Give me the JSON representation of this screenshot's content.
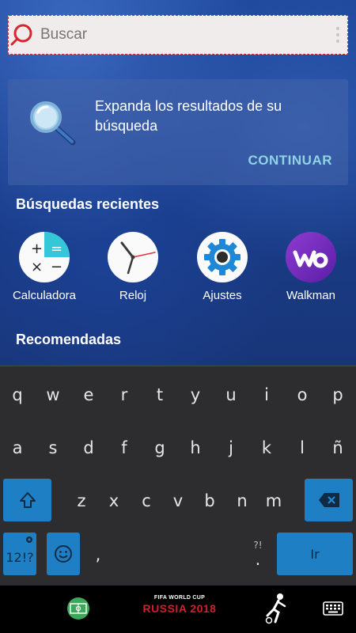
{
  "search": {
    "placeholder": "Buscar"
  },
  "expand_card": {
    "text": "Expanda los resultados de su búsqueda",
    "continue_label": "CONTINUAR"
  },
  "sections": {
    "recent": "Búsquedas recientes",
    "recommended": "Recomendadas"
  },
  "recent_apps": [
    {
      "label": "Calculadora",
      "icon": "calculator-icon"
    },
    {
      "label": "Reloj",
      "icon": "clock-icon"
    },
    {
      "label": "Ajustes",
      "icon": "settings-gear-icon"
    },
    {
      "label": "Walkman",
      "icon": "walkman-icon"
    }
  ],
  "keyboard": {
    "row1": [
      "q",
      "w",
      "e",
      "r",
      "t",
      "y",
      "u",
      "i",
      "o",
      "p"
    ],
    "row2": [
      "a",
      "s",
      "d",
      "f",
      "g",
      "h",
      "j",
      "k",
      "l",
      "ñ"
    ],
    "row3": [
      "z",
      "x",
      "c",
      "v",
      "b",
      "n",
      "m"
    ],
    "symbols_label": "12!?",
    "comma_label": ",",
    "period_label": ".",
    "period_hint": "?!",
    "go_label": "Ir"
  },
  "nav_bar": {
    "wc_top": "FIFA WORLD CUP",
    "wc_main": "RUSSIA 2018"
  },
  "colors": {
    "accent_blue": "#1f7fc4",
    "continue_text": "#8fd3e4",
    "search_text": "#2a67c8",
    "search_border": "#c8323c"
  }
}
